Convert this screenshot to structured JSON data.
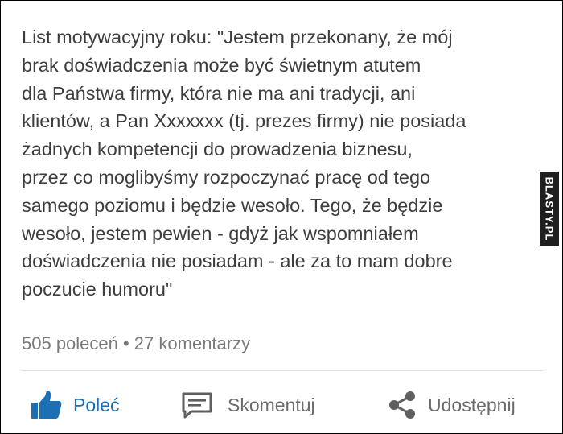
{
  "post": {
    "text": "List motywacyjny roku: \"Jestem przekonany, że mój\nbrak doświadczenia może być świetnym atutem\ndla Państwa firmy, która nie ma ani tradycji, ani\nklientów, a Pan Xxxxxxx (tj. prezes firmy) nie posiada\nżadnych kompetencji do prowadzenia biznesu,\nprzez co moglibyśmy rozpoczynać pracę od tego\nsamego poziomu i będzie wesoło. Tego, że będzie\nwesoło, jestem pewien - gdyż jak wspomniałem\ndoświadczenia nie posiadam - ale za to mam dobre\npoczucie humoru\""
  },
  "stats": {
    "text": "505 poleceń • 27 komentarzy"
  },
  "actions": {
    "like_label": "Poleć",
    "comment_label": "Skomentuj",
    "share_label": "Udostępnij"
  },
  "icons": {
    "like": "thumbs-up-icon",
    "comment": "comment-icon",
    "share": "share-icon"
  },
  "watermark": {
    "text": "BLASTY.PL"
  },
  "colors": {
    "text": "#3d3d3d",
    "muted": "#7a7a7a",
    "accent": "#1a6fb5",
    "icon_gray": "#5f5f5f"
  }
}
